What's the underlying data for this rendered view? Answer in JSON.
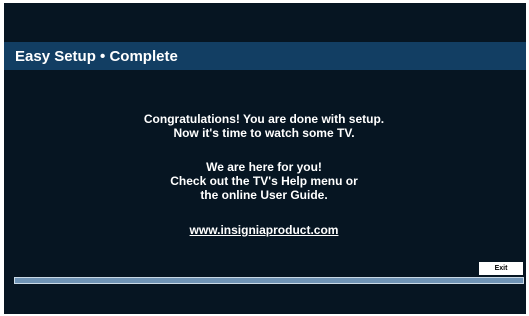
{
  "header": {
    "title": "Easy Setup • Complete"
  },
  "main": {
    "message1": [
      "Congratulations! You are done with setup.",
      "Now it's time to watch some TV."
    ],
    "message2": [
      "We are here for you!",
      "Check out the TV's Help menu or",
      "the online User Guide."
    ],
    "link": "www.insigniaproduct.com"
  },
  "footer": {
    "exit_label": "Exit",
    "progress": 1.0
  },
  "colors": {
    "background": "#061522",
    "title_bar": "#123e63",
    "progress_fill": "#6f93b5"
  }
}
